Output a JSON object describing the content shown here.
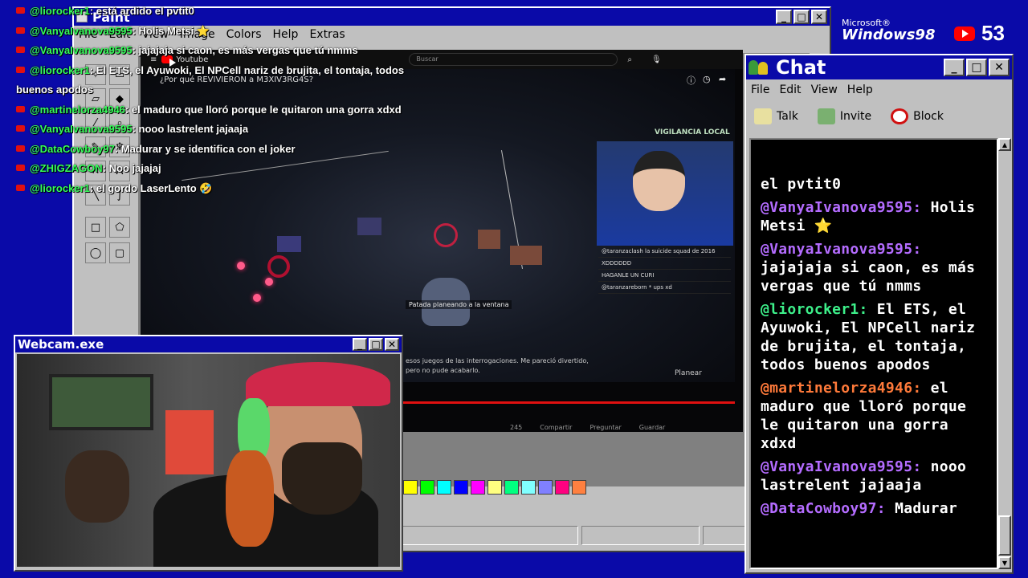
{
  "overlay_chat": [
    {
      "user": "@liorocker1",
      "text": ": está ardido el pvtit0"
    },
    {
      "user": "@VanyaIvanova9595",
      "text": ": Holis Metsi ⭐"
    },
    {
      "user": "@VanyaIvanova9595",
      "text": ": jajajaja si caon, es más vergas que tú nmms"
    },
    {
      "user": "@liorocker1",
      "text": ": El ETS, el Ayuwoki, El NPCell nariz de brujita, el tontaja, todos buenos apodos"
    },
    {
      "user": "@martinelorza4946",
      "text": ": el maduro que lloró porque le quitaron una gorra xdxd"
    },
    {
      "user": "@VanyaIvanova9595",
      "text": ": nooo lastrelent jajaaja"
    },
    {
      "user": "@DataCowboy97",
      "text": ": Madurar y se identifica con el joker"
    },
    {
      "user": "@ZHIGZAGON",
      "text": ": Noo jajajaj"
    },
    {
      "user": "@liorocker1",
      "text": ": el gordo LaserLento 🤣"
    }
  ],
  "paint": {
    "title": "Paint",
    "menu": [
      "File",
      "Edit",
      "View",
      "Image",
      "Colors",
      "Help",
      "Extras"
    ],
    "palette": [
      "#ffff00",
      "#00ff00",
      "#00ffff",
      "#0000ff",
      "#ff00ff",
      "#ffff80",
      "#00ff80",
      "#80ffff",
      "#8080ff",
      "#ff0080",
      "#ff8040"
    ]
  },
  "youtube": {
    "logo": "Youtube",
    "search_placeholder": "Buscar",
    "video_title": "¿Por qué REVIVIERON a M3XIV3RG4S?",
    "vigilancia": "VIGILANCIA LOCAL",
    "hint": "Patada planeando a la ventana",
    "subtitle_1": "esos juegos de las interrogaciones. Me pareció divertido,",
    "subtitle_2": "pero no pude acabarlo.",
    "planear": "Planear",
    "mini_chat": [
      "@taranzaclash la suicide squad de 2016",
      "XDDDDDD",
      "HAGANLE UN CURI",
      "@taranzareborn * ups xd"
    ],
    "actions": [
      "245",
      "Compartir",
      "Preguntar",
      "Guardar"
    ]
  },
  "chat_window": {
    "title": "Chat",
    "menu": [
      "File",
      "Edit",
      "View",
      "Help"
    ],
    "tools": [
      "Talk",
      "Invite",
      "Block"
    ],
    "messages": [
      {
        "user": "",
        "text": "el pvtit0",
        "color": "#ffffff"
      },
      {
        "user": "@VanyaIvanova9595:",
        "text": "Holis Metsi ⭐",
        "color": "#b46cff"
      },
      {
        "user": "@VanyaIvanova9595:",
        "text": "jajajaja si caon, es más vergas que tú nmms",
        "color": "#b46cff"
      },
      {
        "user": "@liorocker1:",
        "text": "El ETS, el Ayuwoki, El NPCell nariz de brujita, el tontaja, todos buenos apodos",
        "color": "#3df08a"
      },
      {
        "user": "@martinelorza4946:",
        "text": "el maduro que lloró porque le quitaron una gorra xdxd",
        "color": "#ff7a3a"
      },
      {
        "user": "@VanyaIvanova9595:",
        "text": "nooo lastrelent jajaaja",
        "color": "#b46cff"
      },
      {
        "user": "@DataCowboy97:",
        "text": "Madurar",
        "color": "#b46cff"
      }
    ]
  },
  "webcam": {
    "title": "Webcam.exe"
  },
  "branding": {
    "microsoft": "Microsoft®",
    "windows": "Windows98",
    "viewer_count": "53"
  }
}
